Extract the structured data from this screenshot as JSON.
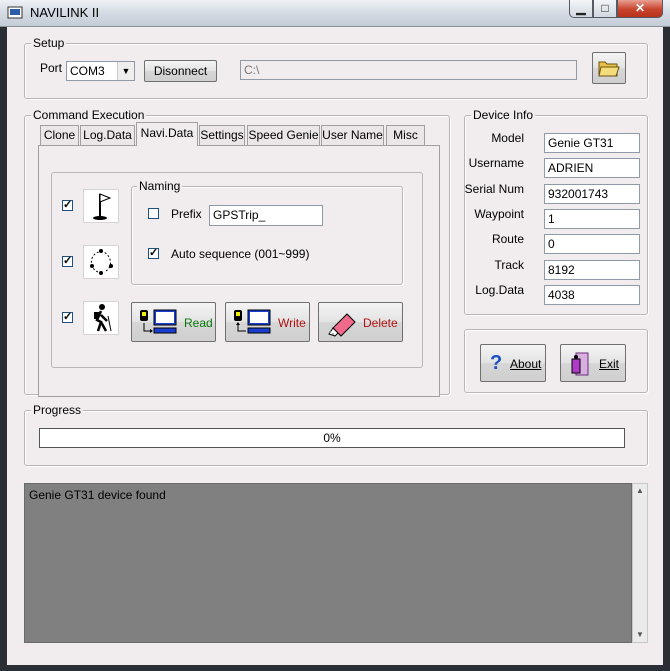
{
  "window": {
    "title": "NAVILINK II"
  },
  "setup": {
    "title": "Setup",
    "port_label": "Port",
    "port_value": "COM3",
    "disconnect_label": "Disonnect",
    "path_value": "C:\\"
  },
  "command": {
    "title": "Command Execution",
    "tabs": [
      {
        "label": "Clone"
      },
      {
        "label": "Log.Data"
      },
      {
        "label": "Navi.Data"
      },
      {
        "label": "Settings"
      },
      {
        "label": "Speed Genie"
      },
      {
        "label": "User Name"
      },
      {
        "label": "Misc"
      }
    ],
    "active_tab": "Navi.Data",
    "naming": {
      "title": "Naming",
      "prefix_label": "Prefix",
      "prefix_checked": false,
      "prefix_value": "GPSTrip_",
      "autoseq_label": "Auto sequence (001~999)",
      "autoseq_checked": true
    },
    "rows": [
      {
        "checked": true,
        "icon": "waypoint-flag-icon"
      },
      {
        "checked": true,
        "icon": "route-icon"
      },
      {
        "checked": true,
        "icon": "track-hiker-icon"
      }
    ],
    "read_label": "Read",
    "write_label": "Write",
    "delete_label": "Delete"
  },
  "device_info": {
    "title": "Device Info",
    "fields": [
      {
        "label": "Model",
        "value": "Genie GT31"
      },
      {
        "label": "Username",
        "value": "ADRIEN"
      },
      {
        "label": "Serial Num",
        "value": "932001743"
      },
      {
        "label": "Waypoint",
        "value": "1"
      },
      {
        "label": "Route",
        "value": "0"
      },
      {
        "label": "Track",
        "value": "8192"
      },
      {
        "label": "Log.Data",
        "value": "4038"
      }
    ]
  },
  "about_label": "About",
  "exit_label": "Exit",
  "progress": {
    "title": "Progress",
    "percent": 0,
    "text": "0%"
  },
  "log": {
    "lines": [
      "Genie GT31 device found"
    ]
  },
  "colors": {
    "read": "#0a7a0a",
    "write": "#b01010",
    "delete": "#b01010"
  }
}
